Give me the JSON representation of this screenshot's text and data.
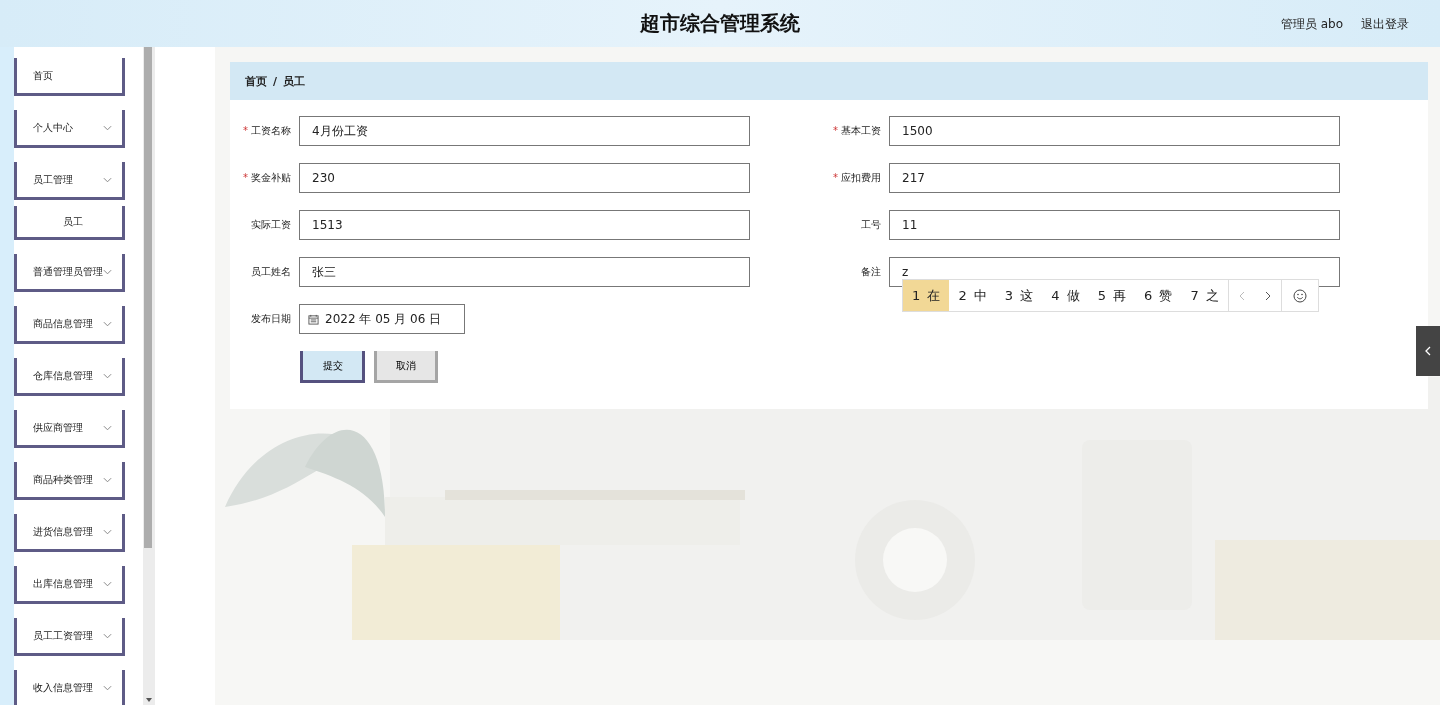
{
  "header": {
    "title": "超市综合管理系统",
    "user": "管理员 abo",
    "logout": "退出登录"
  },
  "sidebar": {
    "items": [
      {
        "label": "首页",
        "kind": "link"
      },
      {
        "label": "个人中心",
        "kind": "group"
      },
      {
        "label": "员工管理",
        "kind": "group",
        "children": [
          {
            "label": "员工"
          }
        ]
      },
      {
        "label": "普通管理员管理",
        "kind": "group"
      },
      {
        "label": "商品信息管理",
        "kind": "group"
      },
      {
        "label": "仓库信息管理",
        "kind": "group"
      },
      {
        "label": "供应商管理",
        "kind": "group"
      },
      {
        "label": "商品种类管理",
        "kind": "group"
      },
      {
        "label": "进货信息管理",
        "kind": "group"
      },
      {
        "label": "出库信息管理",
        "kind": "group"
      },
      {
        "label": "员工工资管理",
        "kind": "group"
      },
      {
        "label": "收入信息管理",
        "kind": "group"
      }
    ]
  },
  "breadcrumb": [
    "首页",
    "/",
    "员工"
  ],
  "form": {
    "fields": [
      {
        "required_mark": "*",
        "label": "工资名称",
        "value": "4月份工资",
        "kind": "text"
      },
      {
        "required_mark": "*",
        "label": "基本工资",
        "value": "1500",
        "kind": "text"
      },
      {
        "required_mark": "*",
        "label": "奖金补贴",
        "value": "230",
        "kind": "text"
      },
      {
        "required_mark": "*",
        "label": "应扣费用",
        "value": "217",
        "kind": "text"
      },
      {
        "label": "实际工资",
        "value": "1513",
        "kind": "text"
      },
      {
        "label": "工号",
        "value": "11",
        "kind": "text"
      },
      {
        "label": "员工姓名",
        "value": "张三",
        "kind": "text"
      },
      {
        "label": "备注",
        "value": "z",
        "kind": "text"
      },
      {
        "label": "发布日期",
        "value": "2022 年 05 月 06 日",
        "kind": "date"
      }
    ],
    "buttons": [
      {
        "label": "提交",
        "kind": "primary"
      },
      {
        "label": "取消",
        "kind": "secondary"
      }
    ]
  },
  "ime_candidates": [
    {
      "label": "1 在",
      "selected": true
    },
    {
      "label": "2 中",
      "selected": false
    },
    {
      "label": "3 这",
      "selected": false
    },
    {
      "label": "4 做",
      "selected": false
    },
    {
      "label": "5 再",
      "selected": false
    },
    {
      "label": "6 赞",
      "selected": false
    },
    {
      "label": "7 之",
      "selected": false
    }
  ]
}
